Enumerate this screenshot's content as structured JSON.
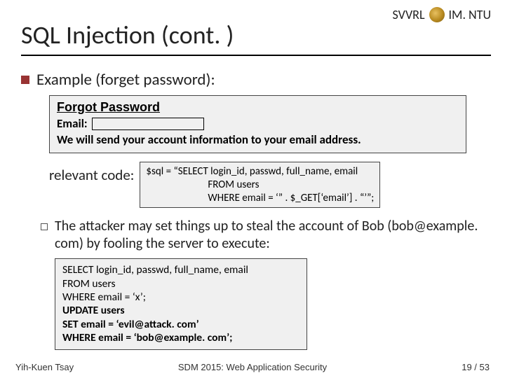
{
  "header": {
    "lab": "SVVRL",
    "org": "IM. NTU"
  },
  "title": "SQL Injection (cont. )",
  "bullet1": "Example (forget password):",
  "formbox": {
    "title": "Forgot Password",
    "email_label": "Email:",
    "info": "We will send your account information to your email address."
  },
  "relcode": {
    "label": "relevant code:",
    "line1": "$sql = “SELECT login_id, passwd, full_name, email",
    "line2": "FROM users",
    "line3": "WHERE email = ‘” . $_GET[‘email’] . “’”;"
  },
  "sub_bullet": "The attacker may set things up to steal the account of Bob (bob@example. com) by fooling the server to execute:",
  "attack_sql": {
    "l1": "SELECT login_id, passwd, full_name, email",
    "l2": "FROM users",
    "l3": "WHERE email = ‘x’;",
    "l4": "UPDATE users",
    "l5": "SET email = ‘evil@attack. com’",
    "l6": "WHERE email = ‘bob@example. com’;"
  },
  "footer": {
    "left": "Yih-Kuen Tsay",
    "center": "SDM 2015: Web Application Security",
    "right": "19 / 53"
  }
}
